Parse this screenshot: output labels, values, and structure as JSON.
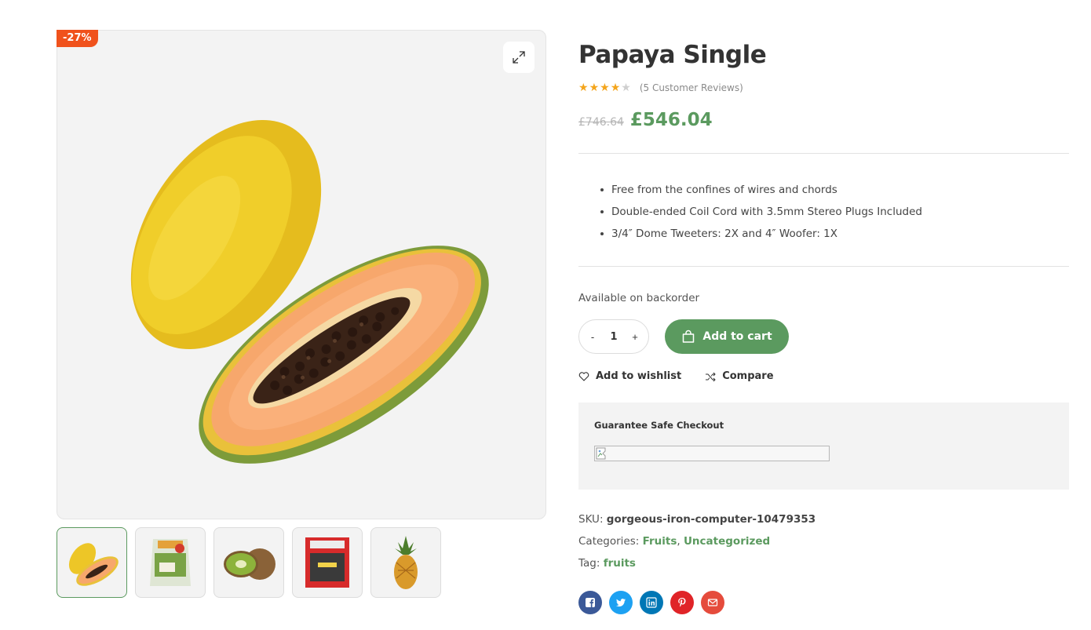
{
  "product": {
    "badge": "-27%",
    "title": "Papaya Single",
    "rating": 4,
    "rating_max": 5,
    "reviews_text": "(5 Customer Reviews)",
    "old_price": "£746.64",
    "price": "£546.04",
    "features": [
      "Free from the confines of wires and chords",
      "Double-ended Coil Cord with 3.5mm Stereo Plugs Included",
      "3/4″ Dome Tweeters: 2X and 4″ Woofer: 1X"
    ],
    "stock_status": "Available on backorder",
    "quantity": "1",
    "qty_minus": "-",
    "qty_plus": "+",
    "add_to_cart": "Add to cart",
    "wishlist": "Add to wishlist",
    "compare": "Compare"
  },
  "guarantee": {
    "title": "Guarantee Safe Checkout"
  },
  "meta": {
    "sku_label": "SKU:",
    "sku": "gorgeous-iron-computer-10479353",
    "categories_label": "Categories:",
    "categories": [
      "Fruits",
      "Uncategorized"
    ],
    "category_separator": ",",
    "tag_label": "Tag:",
    "tag": "fruits"
  },
  "gallery": {
    "thumbnails": [
      "papaya",
      "salad-bag",
      "kiwi",
      "red-pack",
      "pineapple"
    ],
    "active_index": 0
  },
  "share": [
    {
      "icon": "facebook-icon",
      "color": "#3b5998"
    },
    {
      "icon": "twitter-icon",
      "color": "#1da1f2"
    },
    {
      "icon": "linkedin-icon",
      "color": "#0077b5"
    },
    {
      "icon": "pinterest-icon",
      "color": "#e02428"
    },
    {
      "icon": "email-icon",
      "color": "#e54b3c"
    }
  ],
  "colors": {
    "accent": "#5b9a5f",
    "badge": "#f0521c",
    "star": "#f4a51c"
  }
}
